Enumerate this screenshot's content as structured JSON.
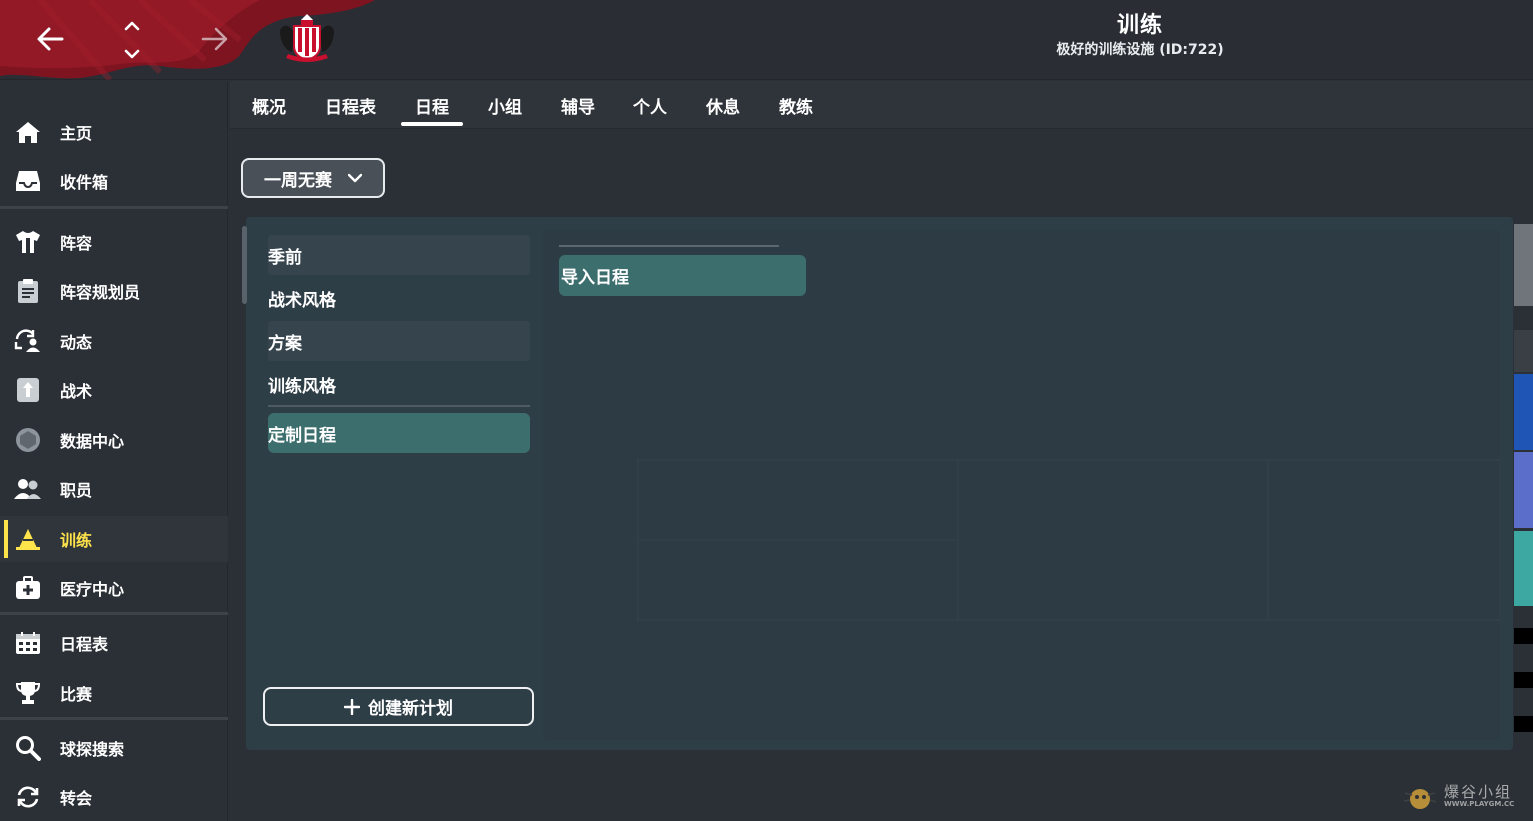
{
  "header": {
    "title": "训练",
    "subtitle": "极好的训练设施 (ID:722)"
  },
  "icons": {
    "back": "arrow-left-icon",
    "forward": "arrow-right-icon",
    "updown": "chevron-up-down-icon",
    "crest": "club-crest-icon"
  },
  "sidebar": {
    "items": [
      {
        "label": "主页",
        "icon": "home-icon"
      },
      {
        "label": "收件箱",
        "icon": "inbox-icon"
      },
      {
        "label": "阵容",
        "icon": "shirt-icon"
      },
      {
        "label": "阵容规划员",
        "icon": "clipboard-icon"
      },
      {
        "label": "动态",
        "icon": "refresh-person-icon"
      },
      {
        "label": "战术",
        "icon": "tactics-icon"
      },
      {
        "label": "数据中心",
        "icon": "data-hub-icon"
      },
      {
        "label": "职员",
        "icon": "staff-icon"
      },
      {
        "label": "训练",
        "icon": "training-cone-icon"
      },
      {
        "label": "医疗中心",
        "icon": "medical-kit-icon"
      },
      {
        "label": "日程表",
        "icon": "calendar-icon"
      },
      {
        "label": "比赛",
        "icon": "trophy-icon"
      },
      {
        "label": "球探搜索",
        "icon": "search-icon"
      },
      {
        "label": "转会",
        "icon": "transfer-icon"
      }
    ],
    "active_index": 8
  },
  "tabs": [
    {
      "label": "概况"
    },
    {
      "label": "日程表"
    },
    {
      "label": "日程"
    },
    {
      "label": "小组"
    },
    {
      "label": "辅导"
    },
    {
      "label": "个人"
    },
    {
      "label": "休息"
    },
    {
      "label": "教练"
    }
  ],
  "active_tab": 2,
  "dropdown": {
    "selected": "一周无赛"
  },
  "schedule_list": {
    "items": [
      {
        "label": "季前"
      },
      {
        "label": "战术风格"
      },
      {
        "label": "方案"
      },
      {
        "label": "训练风格"
      },
      {
        "label": "定制日程"
      }
    ],
    "selected_index": 4
  },
  "buttons": {
    "create_plan": "创建新计划",
    "import_schedule": "导入日程"
  },
  "watermark": {
    "name": "爆谷小组",
    "url": "WWW.PLAYGM.CC"
  },
  "colors": {
    "accent_yellow": "#ffe34a",
    "selected_teal": "#3d6e6e",
    "panel_bg": "#2e3e47",
    "club_red": "#8a1420"
  }
}
